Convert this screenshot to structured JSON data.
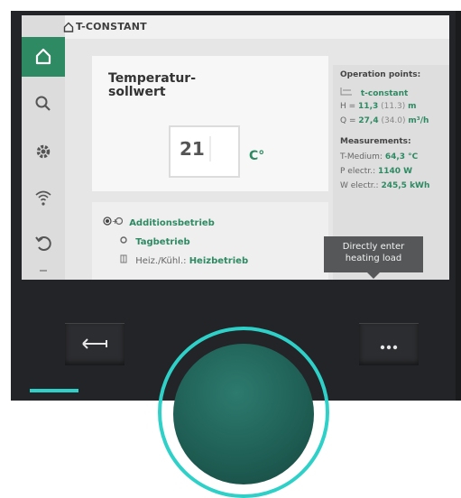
{
  "header": {
    "title": "T-CONSTANT",
    "home_icon": "home-icon"
  },
  "sidebar": {
    "items": [
      {
        "icon": "home-icon",
        "active": true
      },
      {
        "icon": "search-icon"
      },
      {
        "icon": "gear-icon"
      },
      {
        "icon": "wireless-icon"
      },
      {
        "icon": "undo-icon"
      }
    ]
  },
  "setpoint": {
    "label": "Temperatur-\nsollwert",
    "value": "21",
    "unit": "C°"
  },
  "modes": {
    "row1": "Additionsbetrieb",
    "row2": "Tagbetrieb",
    "row3_key": "Heiz./Kühl.:",
    "row3_value": "Heizbetrieb"
  },
  "operation": {
    "heading": "Operation points:",
    "mode": "t-constant",
    "h_key": "H =",
    "h_value": "11,3",
    "h_paren": "(11.3)",
    "h_unit": "m",
    "q_key": "Q =",
    "q_value": "27,4",
    "q_paren": "(34.0)",
    "q_unit": "m³/h"
  },
  "measurements": {
    "heading": "Measurements:",
    "t_key": "T-Medium:",
    "t_value": "64,3 °C",
    "p_key": "P electr.:",
    "p_value": "1140 W",
    "w_key": "W electr.:",
    "w_value": "245,5 kWh"
  },
  "tooltip": {
    "line1": "Directly enter",
    "line2": "heating load"
  },
  "hardware": {
    "back_icon": "back-arrow-icon",
    "more_icon": "more-dots-icon"
  },
  "colors": {
    "accent_green": "#2e8a63",
    "ring_cyan": "#2fd0c8",
    "knob_green": "#1e5d53",
    "device_dark": "#232427"
  }
}
